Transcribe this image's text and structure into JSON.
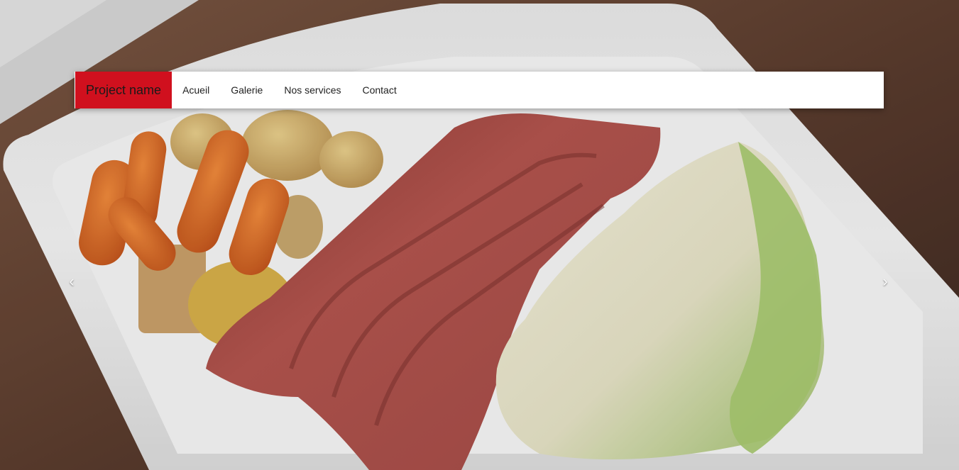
{
  "navbar": {
    "brand": "Project name",
    "links": [
      "Acueil",
      "Galerie",
      "Nos services",
      "Contact"
    ]
  },
  "carousel": {
    "prev_glyph": "‹",
    "next_glyph": "›",
    "slide_image": "corned-beef-plate-photo"
  },
  "colors": {
    "brand_bg": "#d0101e",
    "navbar_bg": "#ffffff"
  }
}
